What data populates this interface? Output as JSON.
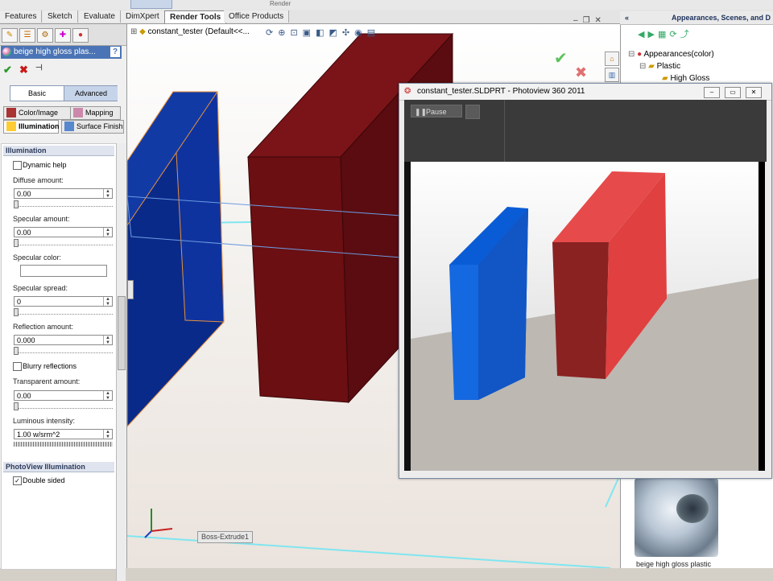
{
  "top": {
    "section": "Render"
  },
  "tabs": [
    "Features",
    "Sketch",
    "Evaluate",
    "DimXpert",
    "Render Tools",
    "Office Products"
  ],
  "active_tab": "Render Tools",
  "left_panel": {
    "title": "beige high gloss plas...",
    "help": "?",
    "mode_basic": "Basic",
    "mode_advanced": "Advanced",
    "tab_color_image": "Color/Image",
    "tab_mapping": "Mapping",
    "tab_illumination": "Illumination",
    "tab_surface_finish": "Surface Finish",
    "group_illumination": "Illumination",
    "dynamic_help": "Dynamic help",
    "diffuse_label": "Diffuse amount:",
    "diffuse_value": "0.00",
    "specular_label": "Specular amount:",
    "specular_value": "0.00",
    "specular_color_label": "Specular color:",
    "specular_spread_label": "Specular spread:",
    "specular_spread_value": "0",
    "reflection_label": "Reflection amount:",
    "reflection_value": "0.000",
    "blurry_reflections": "Blurry reflections",
    "transparent_label": "Transparent amount:",
    "transparent_value": "0.00",
    "luminous_label": "Luminous intensity:",
    "luminous_value": "1.00 w/srm^2",
    "group_photoview": "PhotoView Illumination",
    "double_sided": "Double sided",
    "double_sided_checked": "✓"
  },
  "graphics": {
    "breadcrumb": "constant_tester  (Default<<...",
    "feature_tag": "Boss-Extrude1"
  },
  "right_panel": {
    "header": "Appearances, Scenes, and D",
    "tree_root": "Appearances(color)",
    "tree_plastic": "Plastic",
    "tree_gloss": "High Gloss",
    "preview_label": "beige high gloss plastic"
  },
  "photoview": {
    "title": "constant_tester.SLDPRT - Photoview 360 2011",
    "pause": "Pause"
  },
  "colors": {
    "blue_box": "#0a2a8a",
    "red_box": "#6b0f12",
    "render_blue": "#1468e0",
    "render_red": "#e04040"
  }
}
